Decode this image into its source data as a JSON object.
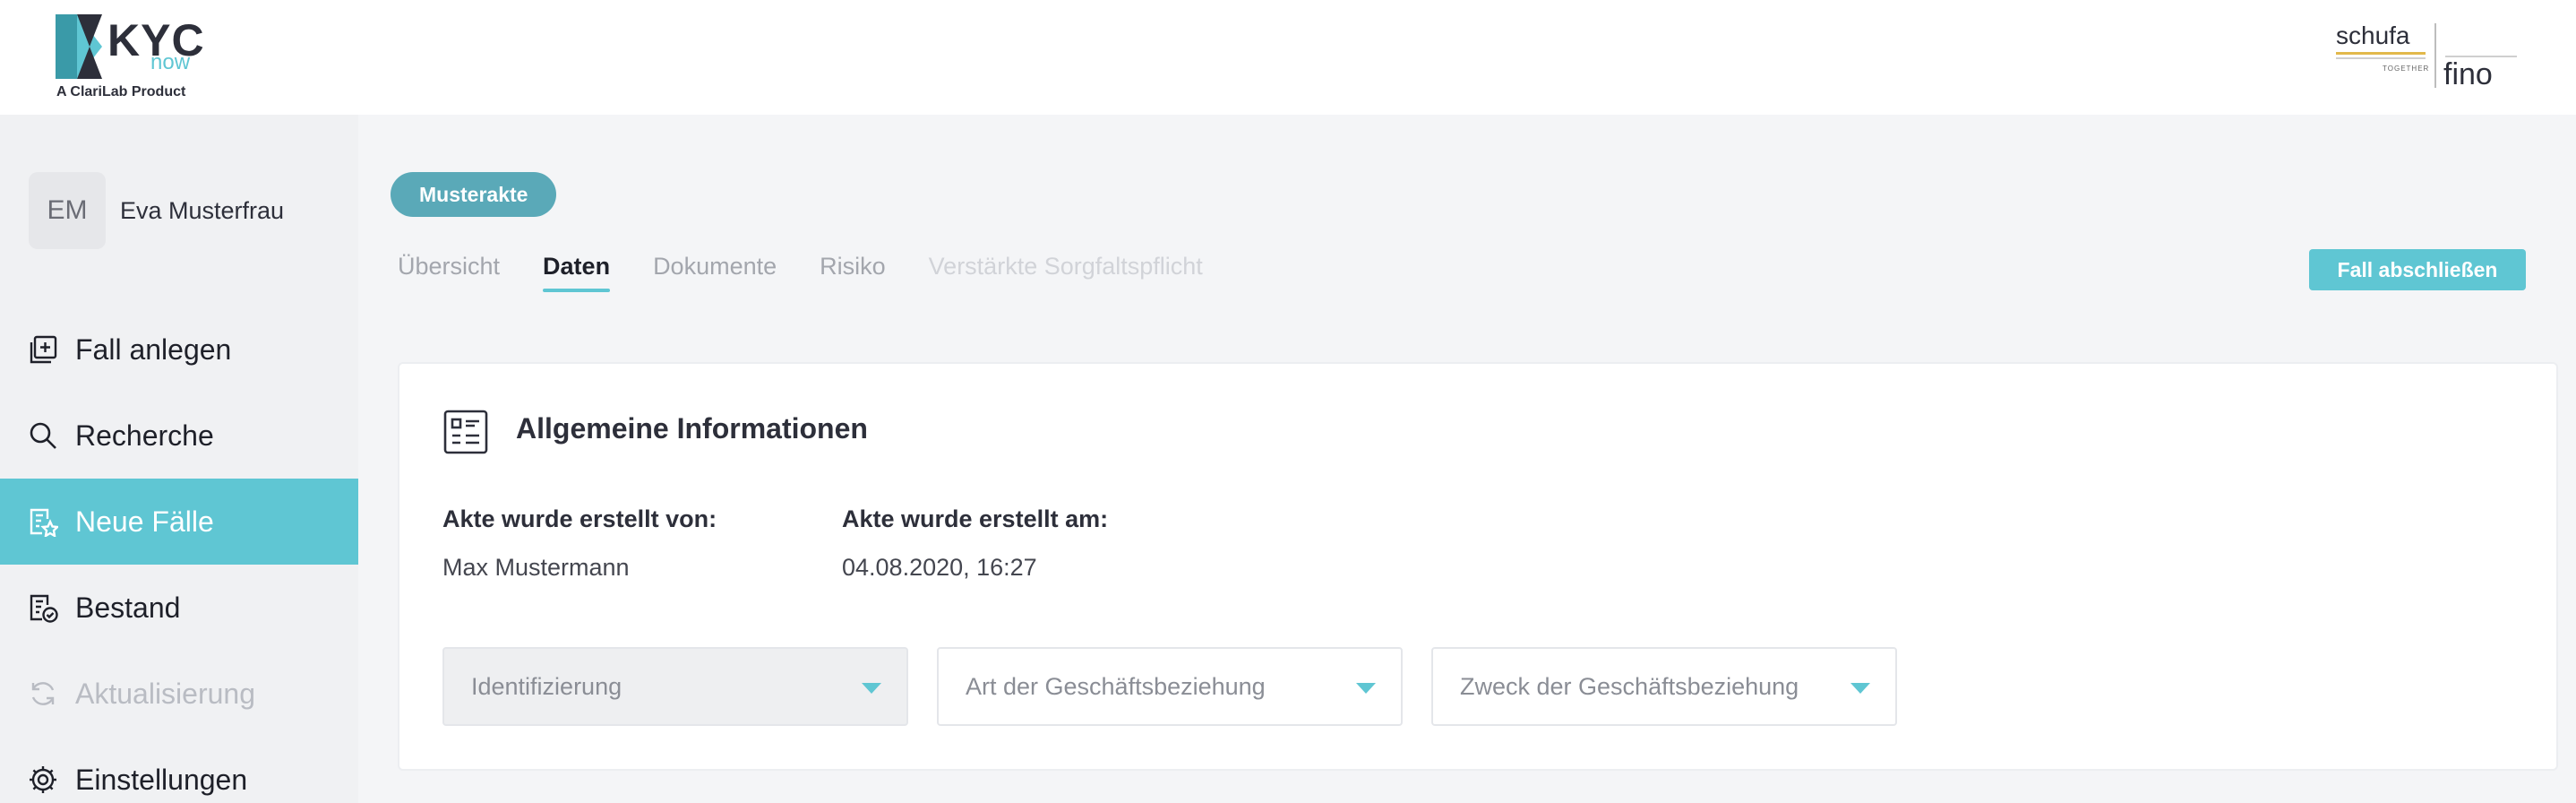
{
  "header": {
    "logo_brand": "KYC",
    "logo_now": "now",
    "logo_tagline": "A ClariLab Product",
    "partner_schufa": "schufa",
    "partner_together": "TOGETHER",
    "partner_fino": "fino"
  },
  "user": {
    "initials": "EM",
    "name": "Eva Musterfrau"
  },
  "sidebar": {
    "items": [
      {
        "label": "Fall anlegen",
        "icon": "add-case-icon"
      },
      {
        "label": "Recherche",
        "icon": "search-icon"
      },
      {
        "label": "Neue Fälle",
        "icon": "new-cases-icon",
        "active": true
      },
      {
        "label": "Bestand",
        "icon": "inventory-icon"
      },
      {
        "label": "Aktualisierung",
        "icon": "refresh-icon",
        "disabled": true
      },
      {
        "label": "Einstellungen",
        "icon": "gear-icon"
      }
    ]
  },
  "case": {
    "badge": "Musterakte",
    "tabs": [
      "Übersicht",
      "Daten",
      "Dokumente",
      "Risiko",
      "Verstärkte Sorgfaltspflicht"
    ],
    "active_tab": "Daten",
    "close_button": "Fall abschließen"
  },
  "card": {
    "title": "Allgemeine Informationen",
    "created_by_label": "Akte wurde erstellt von:",
    "created_by_value": "Max Mustermann",
    "created_at_label": "Akte wurde erstellt am:",
    "created_at_value": "04.08.2020, 16:27",
    "selects": {
      "identification": "Identifizierung",
      "relationship_type": "Art der Geschäftsbeziehung",
      "relationship_purpose": "Zweck der Geschäftsbeziehung"
    }
  },
  "colors": {
    "accent": "#5fc6d3",
    "badge": "#5aa9b8",
    "text": "#2d2f3a",
    "muted": "#a3a6ad"
  }
}
